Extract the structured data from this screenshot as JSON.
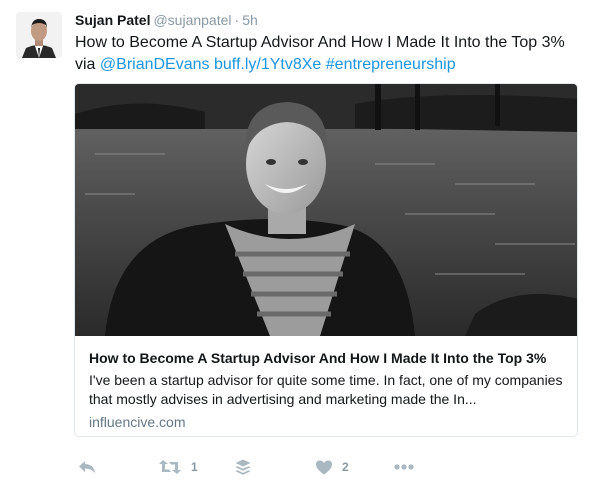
{
  "tweet": {
    "author_name": "Sujan Patel",
    "author_handle": "@sujanpatel",
    "separator": "·",
    "time": "5h",
    "text_line1": "How to Become A Startup Advisor And How I Made It Into the Top 3%",
    "text_via": "via",
    "mention": "@BrianDEvans",
    "short_link": "buff.ly/1Ytv8Xe",
    "hashtag": "#entrepreneurship"
  },
  "card": {
    "title": "How to Become A Startup Advisor And How I Made It Into the Top 3%",
    "description": "I've been a startup advisor for quite some time. In fact, one of my companies that mostly advises in advertising and marketing made the In...",
    "domain": "influencive.com"
  },
  "actions": {
    "retweet_count": "1",
    "like_count": "2",
    "icons": [
      "reply-icon",
      "retweet-icon",
      "buffer-icon",
      "heart-icon",
      "more-icon"
    ]
  },
  "colors": {
    "link": "#1b95e0",
    "muted": "#8899a6",
    "icon": "#aab8c2",
    "border": "#e1e8ed"
  }
}
